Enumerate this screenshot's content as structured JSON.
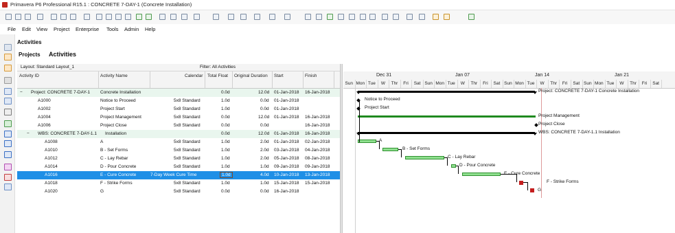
{
  "window": {
    "title": "Primavera P6 Professional R15.1 : CONCRETE 7-DAY-1 (Concrete Installation)"
  },
  "menu": [
    "File",
    "Edit",
    "View",
    "Project",
    "Enterprise",
    "Tools",
    "Admin",
    "Help"
  ],
  "header": {
    "title": "Activities"
  },
  "tabs": {
    "projects": "Projects",
    "activities": "Activities"
  },
  "layout_bar": {
    "layout": "Layout: Standard Layout_1",
    "filter": "Filter: All Activities"
  },
  "columns": {
    "id": "Activity ID",
    "name": "Activity Name",
    "calendar": "Calendar",
    "total_float": "Total Float",
    "orig_duration": "Original Duration",
    "start": "Start",
    "finish": "Finish"
  },
  "rows": [
    {
      "id": "Project: CONCRETE 7-DAY-1",
      "name": "Concrete Installation",
      "calendar": "",
      "tf": "0.0d",
      "od": "12.0d",
      "start": "01-Jan-2018",
      "finish": "16-Jan-2018"
    },
    {
      "id": "A1000",
      "name": "Notice to Proceed",
      "calendar": "5x8 Standard",
      "tf": "1.0d",
      "od": "0.0d",
      "start": "01-Jan-2018",
      "finish": ""
    },
    {
      "id": "A1002",
      "name": "Project Start",
      "calendar": "5x8 Standard",
      "tf": "1.0d",
      "od": "0.0d",
      "start": "01-Jan-2018",
      "finish": ""
    },
    {
      "id": "A1004",
      "name": "Project Management",
      "calendar": "5x8 Standard",
      "tf": "0.0d",
      "od": "12.0d",
      "start": "01-Jan-2018",
      "finish": "16-Jan-2018"
    },
    {
      "id": "A1006",
      "name": "Project Close",
      "calendar": "5x8 Standard",
      "tf": "0.0d",
      "od": "0.0d",
      "start": "",
      "finish": "16-Jan-2018"
    },
    {
      "id": "WBS: CONCRETE 7-DAY-1.1",
      "name": "Installation",
      "calendar": "",
      "tf": "0.0d",
      "od": "12.0d",
      "start": "01-Jan-2018",
      "finish": "16-Jan-2018"
    },
    {
      "id": "A1008",
      "name": "A",
      "calendar": "5x8 Standard",
      "tf": "1.0d",
      "od": "2.0d",
      "start": "01-Jan-2018",
      "finish": "02-Jan-2018"
    },
    {
      "id": "A1010",
      "name": "B - Set Forms",
      "calendar": "5x8 Standard",
      "tf": "1.0d",
      "od": "2.0d",
      "start": "03-Jan-2018",
      "finish": "04-Jan-2018"
    },
    {
      "id": "A1012",
      "name": "C - Lay Rebar",
      "calendar": "5x8 Standard",
      "tf": "1.0d",
      "od": "2.0d",
      "start": "05-Jan-2018",
      "finish": "08-Jan-2018"
    },
    {
      "id": "A1014",
      "name": "D - Pour Concrete",
      "calendar": "5x8 Standard",
      "tf": "1.0d",
      "od": "1.0d",
      "start": "09-Jan-2018",
      "finish": "09-Jan-2018"
    },
    {
      "id": "A1016",
      "name": "E - Cure Concrete",
      "calendar": "7-Day Week Cure Time",
      "tf": "1.0d",
      "od": "4.0d",
      "start": "10-Jan-2018",
      "finish": "13-Jan-2018"
    },
    {
      "id": "A1018",
      "name": "F - Strike Forms",
      "calendar": "5x8 Standard",
      "tf": "1.0d",
      "od": "1.0d",
      "start": "15-Jan-2018",
      "finish": "15-Jan-2018"
    },
    {
      "id": "A1020",
      "name": "G",
      "calendar": "5x8 Standard",
      "tf": "0.0d",
      "od": "0.0d",
      "start": "16-Jan-2018",
      "finish": ""
    }
  ],
  "gantt": {
    "months": [
      "Dec 31",
      "Jan 07",
      "Jan 14",
      "Jan 21"
    ],
    "days": [
      "Sun",
      "Mon",
      "Tue",
      "W",
      "Thr",
      "Fri",
      "Sat",
      "Sun",
      "Mon",
      "Tue",
      "W",
      "Thr",
      "Fri",
      "Sat",
      "Sun",
      "Mon",
      "Tue",
      "W",
      "Thr",
      "Fri",
      "Sat",
      "Sun",
      "Mon",
      "Tue",
      "W",
      "Thr",
      "Fri",
      "Sat"
    ],
    "bar_labels": {
      "project": "Project: CONCRETE 7-DAY-1  Concrete Installation",
      "a1000": "Notice to Proceed",
      "a1002": "Project Start",
      "a1004": "Project Management",
      "a1006": "Project Close",
      "wbs": "WBS: CONCRETE 7-DAY-1.1  Installation",
      "a1008": "A",
      "a1010": "B - Set Forms",
      "a1012": "C - Lay Rebar",
      "a1014": "D - Pour Concrete",
      "a1016": "E - Cure Concrete",
      "a1018": "F - Strike Forms",
      "a1020": "G"
    }
  }
}
